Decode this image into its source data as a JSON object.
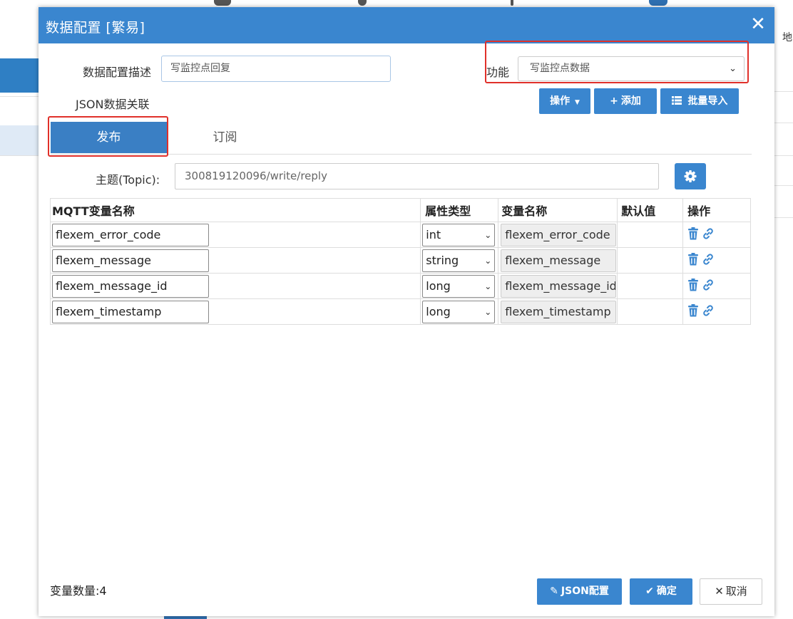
{
  "background": {
    "right_edge_text": "地"
  },
  "modal": {
    "title": "数据配置 [繁易]",
    "close_glyph": "✕",
    "description_label": "数据配置描述",
    "description_value": "写监控点回复",
    "function_label": "功能",
    "function_value": "写监控点数据",
    "json_assoc_label": "JSON数据关联",
    "toolbar": {
      "operate_label": "操作",
      "add_label": "添加",
      "batch_import_label": "批量导入"
    },
    "tabs": [
      {
        "label": "发布",
        "active": true
      },
      {
        "label": "订阅",
        "active": false
      }
    ],
    "topic_label": "主题(Topic):",
    "topic_value": "300819120096/write/reply",
    "table": {
      "headers": [
        "MQTT变量名称",
        "属性类型",
        "变量名称",
        "默认值",
        "操作"
      ],
      "rows": [
        {
          "mqtt_name": "flexem_error_code",
          "type": "int",
          "var_name": "flexem_error_code",
          "default": ""
        },
        {
          "mqtt_name": "flexem_message",
          "type": "string",
          "var_name": "flexem_message",
          "default": ""
        },
        {
          "mqtt_name": "flexem_message_id",
          "type": "long",
          "var_name": "flexem_message_id",
          "default": ""
        },
        {
          "mqtt_name": "flexem_timestamp",
          "type": "long",
          "var_name": "flexem_timestamp",
          "default": ""
        }
      ]
    },
    "variable_count": "变量数量:4",
    "footer": {
      "json_config_label": "JSON配置",
      "confirm_label": "确定",
      "cancel_label": "取消"
    }
  },
  "colors": {
    "primary": "#3a86cf",
    "tab_active": "#3a7fc4",
    "highlight_outline": "#e0302a"
  }
}
